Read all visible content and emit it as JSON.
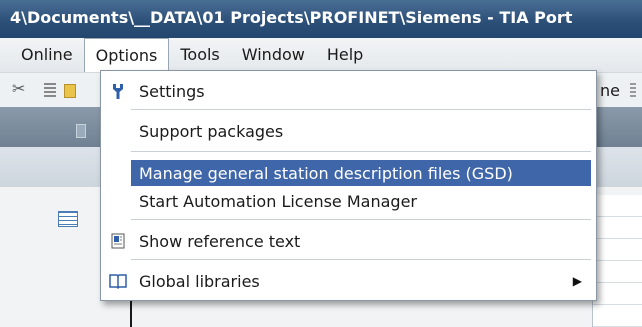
{
  "window": {
    "title": "4\\Documents\\__DATA\\01 Projects\\PROFINET\\Siemens - TIA Port"
  },
  "menubar": {
    "items": [
      "Online",
      "Options",
      "Tools",
      "Window",
      "Help"
    ],
    "active": "Options"
  },
  "toolbar": {
    "partial_text": "ne",
    "icons": [
      "cut-icon",
      "toolbar-grip-icon",
      "folder-icon"
    ]
  },
  "options_menu": {
    "items": [
      {
        "label": "Settings",
        "icon": "wrench-icon"
      },
      {
        "label": "Support packages",
        "icon": ""
      },
      {
        "label": "Manage general station description files (GSD)",
        "icon": "",
        "highlighted": true
      },
      {
        "label": "Start Automation License Manager",
        "icon": ""
      },
      {
        "label": "Show reference text",
        "icon": "reference-text-icon"
      },
      {
        "label": "Global libraries",
        "icon": "book-icon",
        "submenu": true
      }
    ],
    "submenu_arrow": "▶"
  },
  "colors": {
    "titlebar": "#2d5079",
    "highlight": "#3f66a8",
    "menu_border": "#8a96a3"
  }
}
